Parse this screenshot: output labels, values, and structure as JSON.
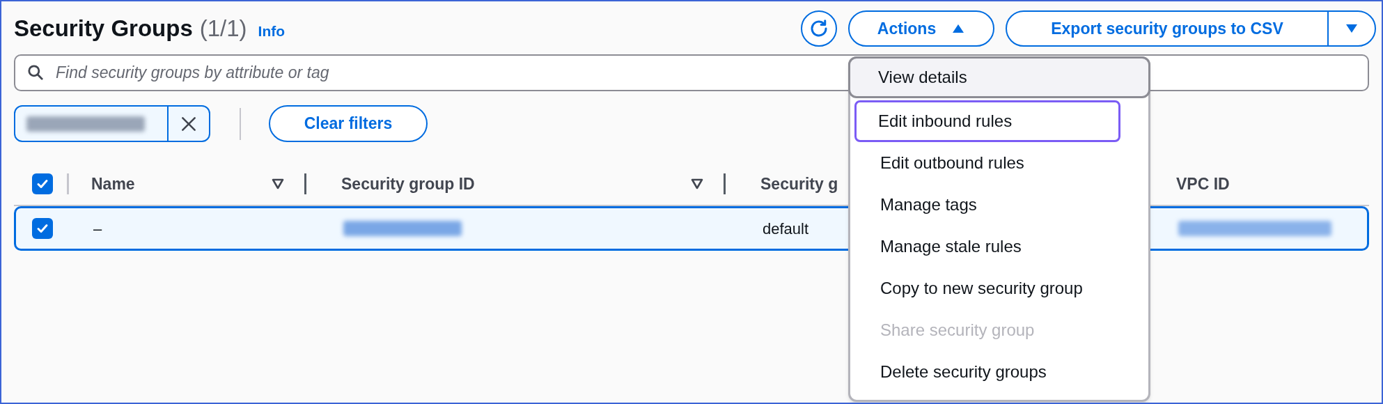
{
  "header": {
    "title": "Security Groups",
    "count": "(1/1)",
    "info_link": "Info"
  },
  "toolbar": {
    "actions_button": {
      "label": "Actions",
      "expanded": true
    },
    "export_button": {
      "label": "Export security groups to CSV"
    }
  },
  "search": {
    "placeholder": "Find security groups by attribute or tag"
  },
  "filters": {
    "clear_button": "Clear filters"
  },
  "table": {
    "select_all_checked": true,
    "columns": [
      {
        "label": "Name",
        "sortable": true
      },
      {
        "label": "Security group ID",
        "sortable": true
      },
      {
        "label": "Security g",
        "sortable": false
      },
      {
        "label": "VPC ID",
        "sortable": false
      }
    ],
    "rows": [
      {
        "selected": true,
        "name": "–",
        "column_3": "default"
      }
    ]
  },
  "actions_menu": [
    {
      "label": "View details",
      "hovered": true,
      "focused": false,
      "disabled": false
    },
    {
      "label": "Edit inbound rules",
      "hovered": false,
      "focused": true,
      "disabled": false
    },
    {
      "label": "Edit outbound rules",
      "hovered": false,
      "focused": false,
      "disabled": false
    },
    {
      "label": "Manage tags",
      "hovered": false,
      "focused": false,
      "disabled": false
    },
    {
      "label": "Manage stale rules",
      "hovered": false,
      "focused": false,
      "disabled": false
    },
    {
      "label": "Copy to new security group",
      "hovered": false,
      "focused": false,
      "disabled": false
    },
    {
      "label": "Share security group",
      "hovered": false,
      "focused": false,
      "disabled": true
    },
    {
      "label": "Delete security groups",
      "hovered": false,
      "focused": false,
      "disabled": false
    }
  ]
}
